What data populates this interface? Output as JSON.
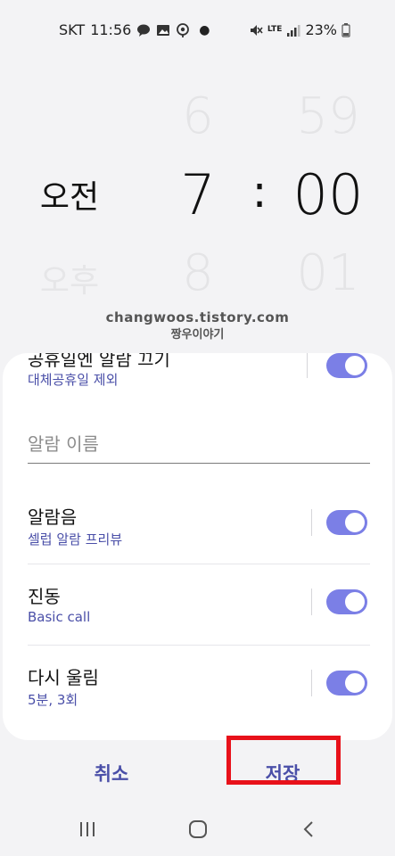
{
  "status_bar": {
    "carrier": "SKT",
    "time": "11:56",
    "network": "LTE",
    "battery": "23%",
    "notification_icons": [
      "talk-icon",
      "gallery-icon",
      "location-icon"
    ],
    "status_icons": [
      "mute-icon",
      "signal-icon",
      "battery-icon"
    ]
  },
  "picker": {
    "ampm_selected": "오전",
    "ampm_other": "오후",
    "hour_prev": "6",
    "hour_selected": "7",
    "hour_next": "8",
    "separator": ":",
    "minute_prev": "59",
    "minute_selected": "00",
    "minute_next": "01"
  },
  "watermark": {
    "line1": "changwoos.tistory.com",
    "line2": "짱우이야기"
  },
  "settings": {
    "holiday_partial_title": "공휴일엔 알람 끄기",
    "holiday_sub": "대체공휴일 제외",
    "alarm_name_placeholder": "알람 이름",
    "sound_title": "알람음",
    "sound_sub": "셀럽 알람 프리뷰",
    "vibration_title": "진동",
    "vibration_sub": "Basic call",
    "snooze_title": "다시 울림",
    "snooze_sub": "5분, 3회"
  },
  "toggles": {
    "holiday": true,
    "sound": true,
    "vibration": true,
    "snooze": true
  },
  "actions": {
    "cancel": "취소",
    "save": "저장"
  },
  "colors": {
    "accent": "#4a4fa8",
    "toggle_on": "#7b7fe6",
    "highlight": "#e8111a",
    "background": "#f3f3f5"
  }
}
